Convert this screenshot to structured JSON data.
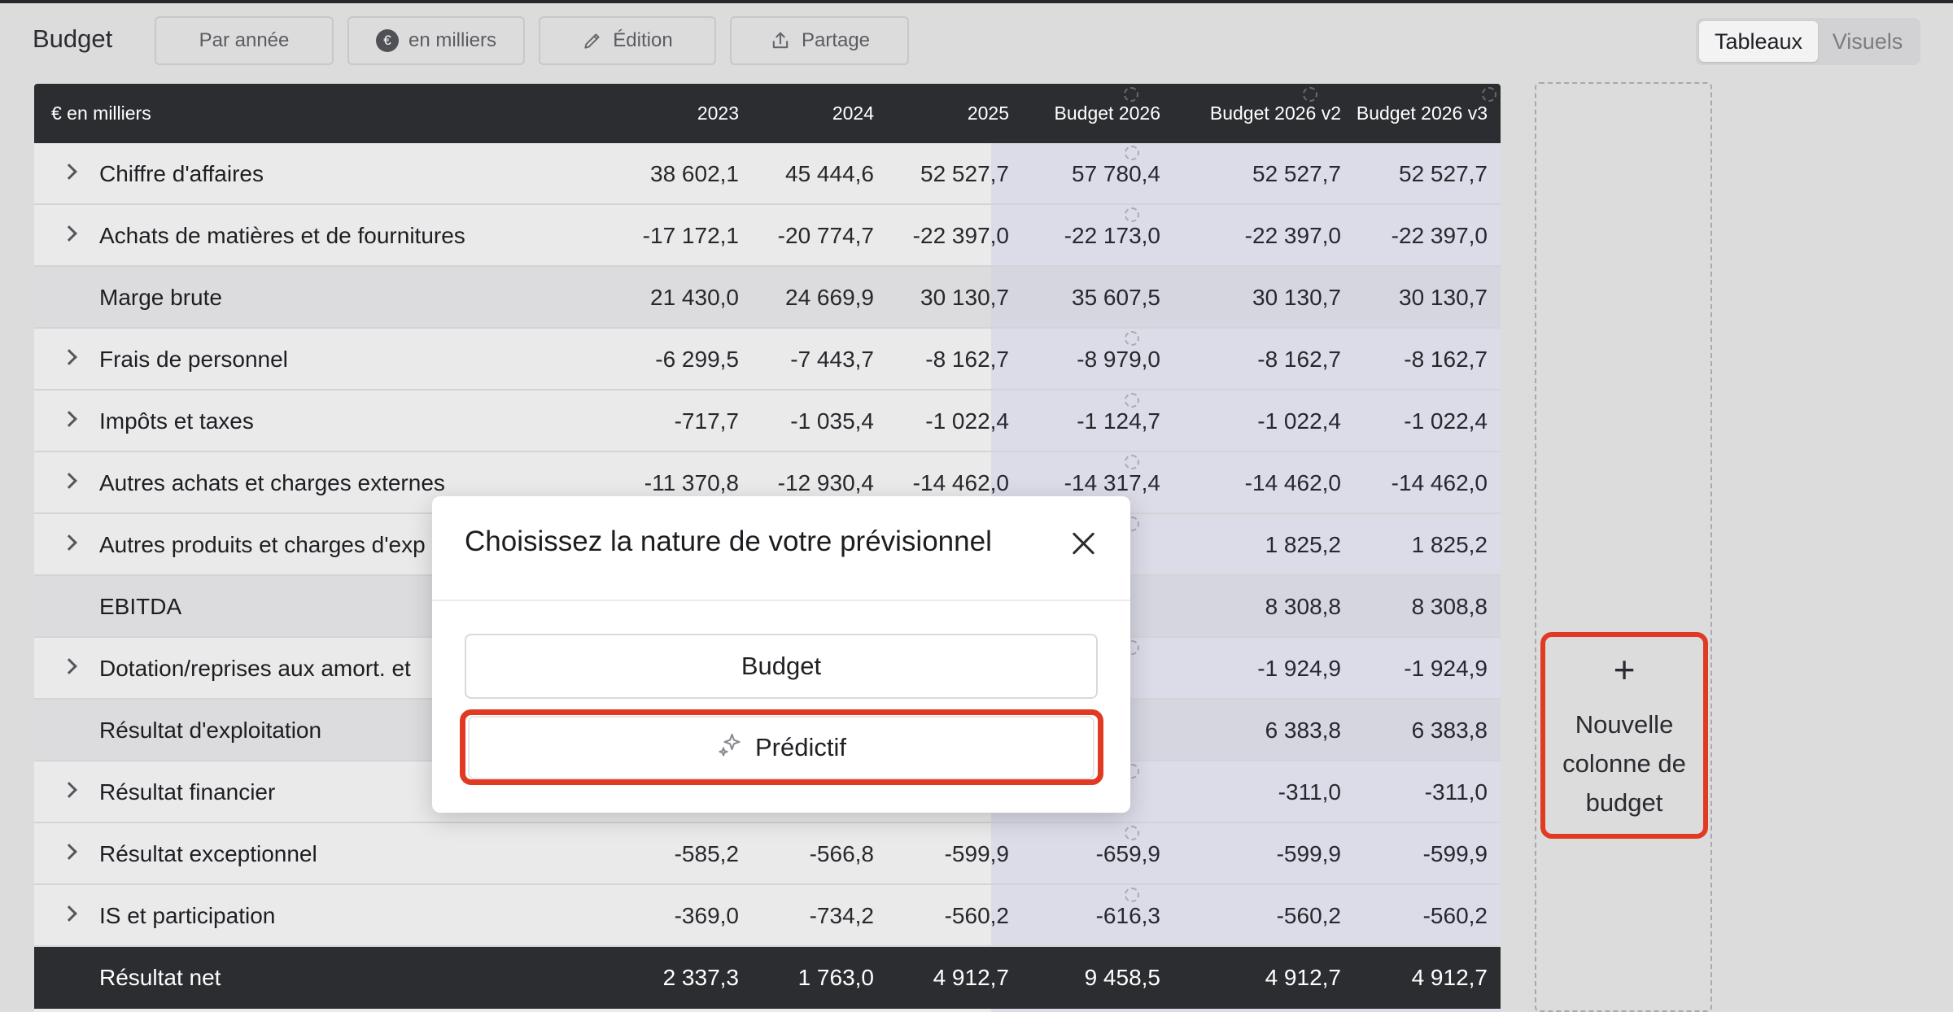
{
  "toolbar": {
    "title": "Budget",
    "by_year_label": "Par année",
    "currency_badge": "€",
    "thousands_label": "en milliers",
    "edit_label": "Édition",
    "share_label": "Partage",
    "view_tabs": {
      "tables": "Tableaux",
      "visuals": "Visuels",
      "active": "Tableaux"
    }
  },
  "table": {
    "header": {
      "label": "€ en milliers",
      "columns": [
        "2023",
        "2024",
        "2025",
        "Budget 2026",
        "Budget 2026 v2",
        "Budget 2026 v3"
      ]
    },
    "rows": [
      {
        "label": "Chiffre d'affaires",
        "expandable": true,
        "values": [
          "38 602,1",
          "45 444,6",
          "52 527,7",
          "57 780,4",
          "52 527,7",
          "52 527,7"
        ]
      },
      {
        "label": "Achats de matières et de fournitures",
        "expandable": true,
        "values": [
          "-17 172,1",
          "-20 774,7",
          "-22 397,0",
          "-22 173,0",
          "-22 397,0",
          "-22 397,0"
        ]
      },
      {
        "label": "Marge brute",
        "subtotal": true,
        "values": [
          "21 430,0",
          "24 669,9",
          "30 130,7",
          "35 607,5",
          "30 130,7",
          "30 130,7"
        ]
      },
      {
        "label": "Frais de personnel",
        "expandable": true,
        "values": [
          "-6 299,5",
          "-7 443,7",
          "-8 162,7",
          "-8 979,0",
          "-8 162,7",
          "-8 162,7"
        ]
      },
      {
        "label": "Impôts et taxes",
        "expandable": true,
        "values": [
          "-717,7",
          "-1 035,4",
          "-1 022,4",
          "-1 124,7",
          "-1 022,4",
          "-1 022,4"
        ]
      },
      {
        "label": "Autres achats et charges externes",
        "expandable": true,
        "values": [
          "-11 370,8",
          "-12 930,4",
          "-14 462,0",
          "-14 317,4",
          "-14 462,0",
          "-14 462,0"
        ]
      },
      {
        "label": "Autres produits et charges d'exp",
        "expandable": true,
        "values": [
          "",
          "",
          "",
          "",
          "1 825,2",
          "1 825,2"
        ]
      },
      {
        "label": "EBITDA",
        "subtotal": true,
        "values": [
          "",
          "",
          "",
          "",
          "8 308,8",
          "8 308,8"
        ]
      },
      {
        "label": "Dotation/reprises aux amort. et",
        "expandable": true,
        "values": [
          "",
          "",
          "",
          "",
          "-1 924,9",
          "-1 924,9"
        ]
      },
      {
        "label": "Résultat d'exploitation",
        "subtotal": true,
        "values": [
          "",
          "",
          "",
          "",
          "6 383,8",
          "6 383,8"
        ]
      },
      {
        "label": "Résultat financier",
        "expandable": true,
        "values": [
          "",
          "",
          "",
          "",
          "-311,0",
          "-311,0"
        ]
      },
      {
        "label": "Résultat exceptionnel",
        "expandable": true,
        "values": [
          "-585,2",
          "-566,8",
          "-599,9",
          "-659,9",
          "-599,9",
          "-599,9"
        ]
      },
      {
        "label": "IS et participation",
        "expandable": true,
        "values": [
          "-369,0",
          "-734,2",
          "-560,2",
          "-616,3",
          "-560,2",
          "-560,2"
        ]
      },
      {
        "label": "Résultat net",
        "total": true,
        "values": [
          "2 337,3",
          "1 763,0",
          "4 912,7",
          "9 458,5",
          "4 912,7",
          "4 912,7"
        ]
      }
    ]
  },
  "add_column": {
    "plus": "+",
    "label": "Nouvelle colonne de budget"
  },
  "modal": {
    "title": "Choisissez la nature de votre prévisionnel",
    "options": [
      "Budget",
      "Prédictif"
    ],
    "predict_icon": "sparkles-icon"
  },
  "colors": {
    "header_bg": "#2c2d31",
    "budget_column_bg": "#dbdce8",
    "highlight": "#e03a22",
    "page_bg": "#dcdcdd"
  }
}
